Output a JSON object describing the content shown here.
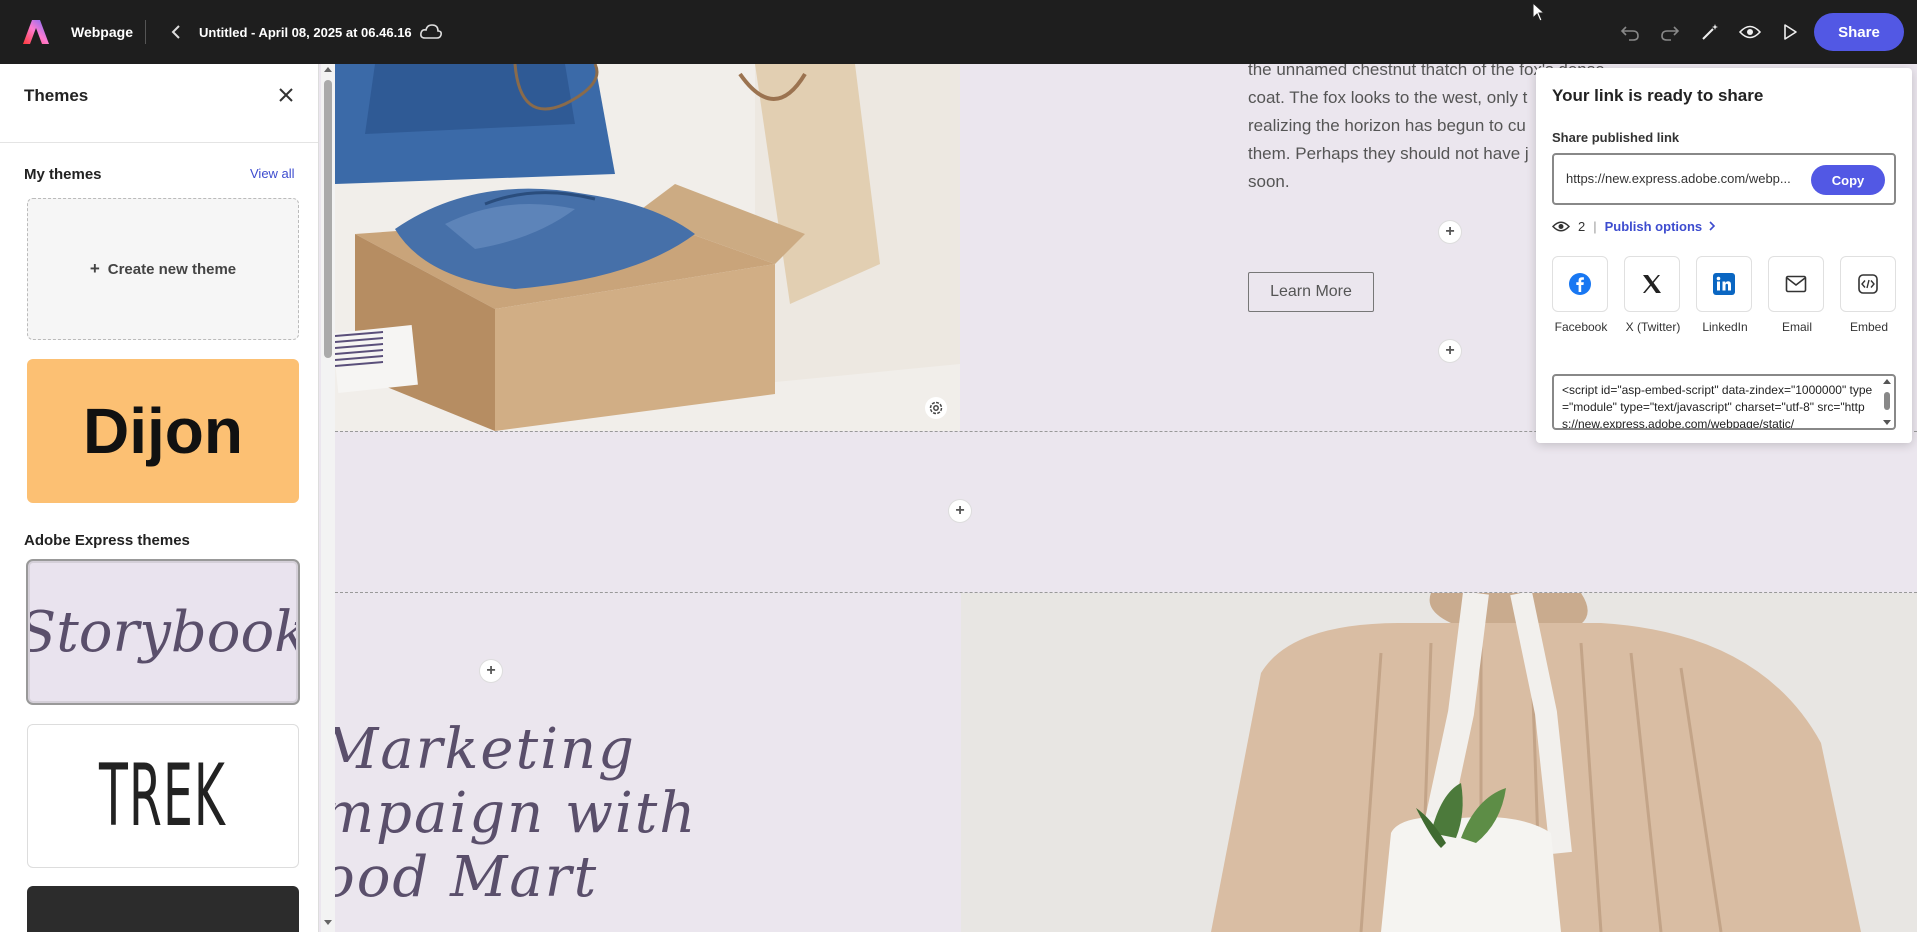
{
  "topbar": {
    "app_name": "Webpage",
    "doc_title": "Untitled - April 08, 2025 at 06.46.16",
    "share_label": "Share"
  },
  "themes_panel": {
    "title": "Themes",
    "my_themes_label": "My themes",
    "view_all_label": "View all",
    "create_new_label": "Create new theme",
    "dijon_label": "Dijon",
    "adobe_themes_label": "Adobe Express themes",
    "storybook_label": "Storybook",
    "trek_label": "TREK"
  },
  "canvas": {
    "body_text": [
      "the unnamed chestnut thatch of the fox's dense",
      "coat. The fox looks to the west, only t",
      "realizing the horizon has begun to cu",
      "them. Perhaps they should not have j",
      "soon."
    ],
    "learn_more_label": "Learn More",
    "script_title_lines": [
      "Marketing",
      "mpaign with",
      "ood Mart"
    ]
  },
  "share_popover": {
    "title": "Your link is ready to share",
    "published_link_label": "Share published link",
    "link_url": "https://new.express.adobe.com/webp...",
    "copy_label": "Copy",
    "view_count": "2",
    "publish_options_label": "Publish options",
    "targets": [
      {
        "label": "Facebook",
        "icon": "facebook-icon"
      },
      {
        "label": "X (Twitter)",
        "icon": "x-twitter-icon"
      },
      {
        "label": "LinkedIn",
        "icon": "linkedin-icon"
      },
      {
        "label": "Email",
        "icon": "email-icon"
      },
      {
        "label": "Embed",
        "icon": "embed-icon"
      }
    ],
    "embed_code": "<script id=\"asp-embed-script\" data-zindex=\"1000000\" type=\"module\" type=\"text/javascript\" charset=\"utf-8\" src=\"https://new.express.adobe.com/webpage/static/"
  },
  "colors": {
    "accent": "#5258e4",
    "topbar_bg": "#1e1e1e",
    "canvas_bg": "#ebe6ee",
    "dijon_bg": "#fcc073",
    "link": "#3d4ccf"
  }
}
